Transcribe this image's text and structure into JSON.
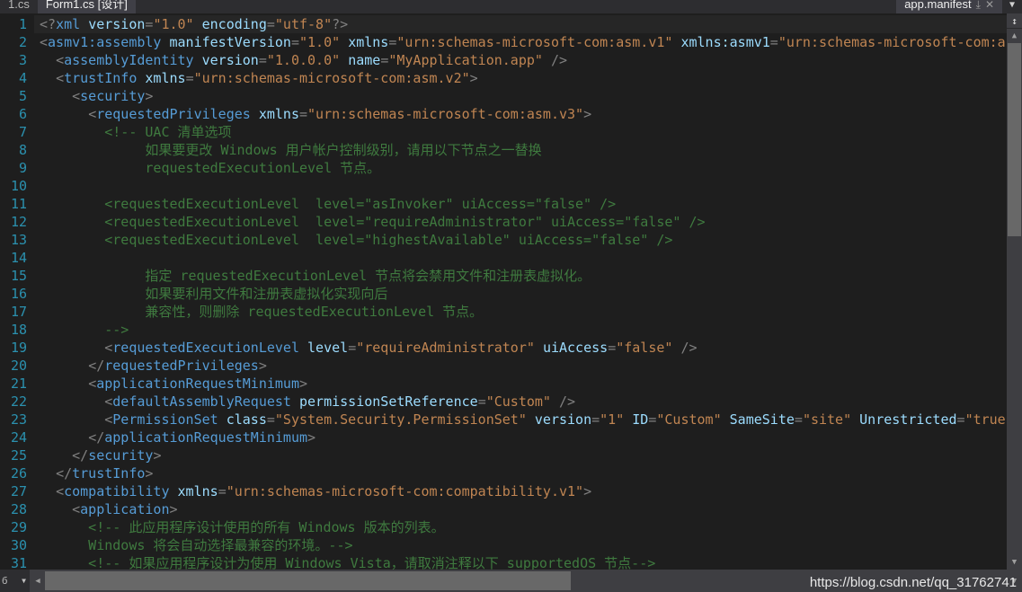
{
  "window": {
    "theme_background": "#1e1e1e",
    "accent_color": "#569cd6"
  },
  "tabs": {
    "items": [
      {
        "label": "1.cs",
        "state": "inactive",
        "truncated": true
      },
      {
        "label": "Form1.cs [设计]",
        "state": "active"
      }
    ],
    "right_tab": {
      "label": "app.manifest",
      "state": "active",
      "pin_icon": "⤓",
      "close_icon": "✕"
    },
    "overflow_icon": "▼"
  },
  "editor": {
    "language": "XML",
    "current_line": 1,
    "lines": [
      {
        "n": "1",
        "current": true,
        "tokens": [
          {
            "c": "punct",
            "t": "<?"
          },
          {
            "c": "tag",
            "t": "xml"
          },
          {
            "c": "plain",
            "t": " "
          },
          {
            "c": "attr",
            "t": "version"
          },
          {
            "c": "punct",
            "t": "="
          },
          {
            "c": "val",
            "t": "\"1.0\""
          },
          {
            "c": "plain",
            "t": " "
          },
          {
            "c": "attr",
            "t": "encoding"
          },
          {
            "c": "punct",
            "t": "="
          },
          {
            "c": "val",
            "t": "\"utf-8\""
          },
          {
            "c": "punct",
            "t": "?>"
          }
        ]
      },
      {
        "n": "2",
        "tokens": [
          {
            "c": "punct",
            "t": "<"
          },
          {
            "c": "tag",
            "t": "asmv1:assembly"
          },
          {
            "c": "plain",
            "t": " "
          },
          {
            "c": "attr",
            "t": "manifestVersion"
          },
          {
            "c": "punct",
            "t": "="
          },
          {
            "c": "val",
            "t": "\"1.0\""
          },
          {
            "c": "plain",
            "t": " "
          },
          {
            "c": "attr",
            "t": "xmlns"
          },
          {
            "c": "punct",
            "t": "="
          },
          {
            "c": "val",
            "t": "\"urn:schemas-microsoft-com:asm.v1\""
          },
          {
            "c": "plain",
            "t": " "
          },
          {
            "c": "attr",
            "t": "xmlns:asmv1"
          },
          {
            "c": "punct",
            "t": "="
          },
          {
            "c": "val",
            "t": "\"urn:schemas-microsoft-com:a"
          }
        ]
      },
      {
        "n": "3",
        "tokens": [
          {
            "c": "plain",
            "t": "  "
          },
          {
            "c": "punct",
            "t": "<"
          },
          {
            "c": "tag",
            "t": "assemblyIdentity"
          },
          {
            "c": "plain",
            "t": " "
          },
          {
            "c": "attr",
            "t": "version"
          },
          {
            "c": "punct",
            "t": "="
          },
          {
            "c": "val",
            "t": "\"1.0.0.0\""
          },
          {
            "c": "plain",
            "t": " "
          },
          {
            "c": "attr",
            "t": "name"
          },
          {
            "c": "punct",
            "t": "="
          },
          {
            "c": "val",
            "t": "\"MyApplication.app\""
          },
          {
            "c": "plain",
            "t": " "
          },
          {
            "c": "punct",
            "t": "/>"
          }
        ]
      },
      {
        "n": "4",
        "tokens": [
          {
            "c": "plain",
            "t": "  "
          },
          {
            "c": "punct",
            "t": "<"
          },
          {
            "c": "tag",
            "t": "trustInfo"
          },
          {
            "c": "plain",
            "t": " "
          },
          {
            "c": "attr",
            "t": "xmlns"
          },
          {
            "c": "punct",
            "t": "="
          },
          {
            "c": "val",
            "t": "\"urn:schemas-microsoft-com:asm.v2\""
          },
          {
            "c": "punct",
            "t": ">"
          }
        ]
      },
      {
        "n": "5",
        "tokens": [
          {
            "c": "plain",
            "t": "    "
          },
          {
            "c": "punct",
            "t": "<"
          },
          {
            "c": "tag",
            "t": "security"
          },
          {
            "c": "punct",
            "t": ">"
          }
        ]
      },
      {
        "n": "6",
        "tokens": [
          {
            "c": "plain",
            "t": "      "
          },
          {
            "c": "punct",
            "t": "<"
          },
          {
            "c": "tag",
            "t": "requestedPrivileges"
          },
          {
            "c": "plain",
            "t": " "
          },
          {
            "c": "attr",
            "t": "xmlns"
          },
          {
            "c": "punct",
            "t": "="
          },
          {
            "c": "val",
            "t": "\"urn:schemas-microsoft-com:asm.v3\""
          },
          {
            "c": "punct",
            "t": ">"
          }
        ]
      },
      {
        "n": "7",
        "tokens": [
          {
            "c": "comment",
            "t": "        <!-- UAC 清单选项"
          }
        ]
      },
      {
        "n": "8",
        "tokens": [
          {
            "c": "comment",
            "t": "             如果要更改 Windows 用户帐户控制级别，请用以下节点之一替换"
          }
        ]
      },
      {
        "n": "9",
        "tokens": [
          {
            "c": "comment",
            "t": "             requestedExecutionLevel 节点。"
          }
        ]
      },
      {
        "n": "10",
        "tokens": [
          {
            "c": "comment",
            "t": ""
          }
        ]
      },
      {
        "n": "11",
        "tokens": [
          {
            "c": "comment",
            "t": "        <requestedExecutionLevel  level=\"asInvoker\" uiAccess=\"false\" />"
          }
        ]
      },
      {
        "n": "12",
        "tokens": [
          {
            "c": "comment",
            "t": "        <requestedExecutionLevel  level=\"requireAdministrator\" uiAccess=\"false\" />"
          }
        ]
      },
      {
        "n": "13",
        "tokens": [
          {
            "c": "comment",
            "t": "        <requestedExecutionLevel  level=\"highestAvailable\" uiAccess=\"false\" />"
          }
        ]
      },
      {
        "n": "14",
        "tokens": [
          {
            "c": "comment",
            "t": ""
          }
        ]
      },
      {
        "n": "15",
        "tokens": [
          {
            "c": "comment",
            "t": "             指定 requestedExecutionLevel 节点将会禁用文件和注册表虚拟化。"
          }
        ]
      },
      {
        "n": "16",
        "tokens": [
          {
            "c": "comment",
            "t": "             如果要利用文件和注册表虚拟化实现向后"
          }
        ]
      },
      {
        "n": "17",
        "tokens": [
          {
            "c": "comment",
            "t": "             兼容性，则删除 requestedExecutionLevel 节点。"
          }
        ]
      },
      {
        "n": "18",
        "tokens": [
          {
            "c": "comment",
            "t": "        -->"
          }
        ]
      },
      {
        "n": "19",
        "tokens": [
          {
            "c": "plain",
            "t": "        "
          },
          {
            "c": "punct",
            "t": "<"
          },
          {
            "c": "tag",
            "t": "requestedExecutionLevel"
          },
          {
            "c": "plain",
            "t": " "
          },
          {
            "c": "attr",
            "t": "level"
          },
          {
            "c": "punct",
            "t": "="
          },
          {
            "c": "val",
            "t": "\"requireAdministrator\""
          },
          {
            "c": "plain",
            "t": " "
          },
          {
            "c": "attr",
            "t": "uiAccess"
          },
          {
            "c": "punct",
            "t": "="
          },
          {
            "c": "val",
            "t": "\"false\""
          },
          {
            "c": "plain",
            "t": " "
          },
          {
            "c": "punct",
            "t": "/>"
          }
        ]
      },
      {
        "n": "20",
        "tokens": [
          {
            "c": "plain",
            "t": "      "
          },
          {
            "c": "punct",
            "t": "</"
          },
          {
            "c": "tag",
            "t": "requestedPrivileges"
          },
          {
            "c": "punct",
            "t": ">"
          }
        ]
      },
      {
        "n": "21",
        "tokens": [
          {
            "c": "plain",
            "t": "      "
          },
          {
            "c": "punct",
            "t": "<"
          },
          {
            "c": "tag",
            "t": "applicationRequestMinimum"
          },
          {
            "c": "punct",
            "t": ">"
          }
        ]
      },
      {
        "n": "22",
        "tokens": [
          {
            "c": "plain",
            "t": "        "
          },
          {
            "c": "punct",
            "t": "<"
          },
          {
            "c": "tag",
            "t": "defaultAssemblyRequest"
          },
          {
            "c": "plain",
            "t": " "
          },
          {
            "c": "attr",
            "t": "permissionSetReference"
          },
          {
            "c": "punct",
            "t": "="
          },
          {
            "c": "val",
            "t": "\"Custom\""
          },
          {
            "c": "plain",
            "t": " "
          },
          {
            "c": "punct",
            "t": "/>"
          }
        ]
      },
      {
        "n": "23",
        "tokens": [
          {
            "c": "plain",
            "t": "        "
          },
          {
            "c": "punct",
            "t": "<"
          },
          {
            "c": "tag",
            "t": "PermissionSet"
          },
          {
            "c": "plain",
            "t": " "
          },
          {
            "c": "attr",
            "t": "class"
          },
          {
            "c": "punct",
            "t": "="
          },
          {
            "c": "val",
            "t": "\"System.Security.PermissionSet\""
          },
          {
            "c": "plain",
            "t": " "
          },
          {
            "c": "attr",
            "t": "version"
          },
          {
            "c": "punct",
            "t": "="
          },
          {
            "c": "val",
            "t": "\"1\""
          },
          {
            "c": "plain",
            "t": " "
          },
          {
            "c": "attr",
            "t": "ID"
          },
          {
            "c": "punct",
            "t": "="
          },
          {
            "c": "val",
            "t": "\"Custom\""
          },
          {
            "c": "plain",
            "t": " "
          },
          {
            "c": "attr",
            "t": "SameSite"
          },
          {
            "c": "punct",
            "t": "="
          },
          {
            "c": "val",
            "t": "\"site\""
          },
          {
            "c": "plain",
            "t": " "
          },
          {
            "c": "attr",
            "t": "Unrestricted"
          },
          {
            "c": "punct",
            "t": "="
          },
          {
            "c": "val",
            "t": "\"true"
          }
        ]
      },
      {
        "n": "24",
        "tokens": [
          {
            "c": "plain",
            "t": "      "
          },
          {
            "c": "punct",
            "t": "</"
          },
          {
            "c": "tag",
            "t": "applicationRequestMinimum"
          },
          {
            "c": "punct",
            "t": ">"
          }
        ]
      },
      {
        "n": "25",
        "tokens": [
          {
            "c": "plain",
            "t": "    "
          },
          {
            "c": "punct",
            "t": "</"
          },
          {
            "c": "tag",
            "t": "security"
          },
          {
            "c": "punct",
            "t": ">"
          }
        ]
      },
      {
        "n": "26",
        "tokens": [
          {
            "c": "plain",
            "t": "  "
          },
          {
            "c": "punct",
            "t": "</"
          },
          {
            "c": "tag",
            "t": "trustInfo"
          },
          {
            "c": "punct",
            "t": ">"
          }
        ]
      },
      {
        "n": "27",
        "tokens": [
          {
            "c": "plain",
            "t": "  "
          },
          {
            "c": "punct",
            "t": "<"
          },
          {
            "c": "tag",
            "t": "compatibility"
          },
          {
            "c": "plain",
            "t": " "
          },
          {
            "c": "attr",
            "t": "xmlns"
          },
          {
            "c": "punct",
            "t": "="
          },
          {
            "c": "val",
            "t": "\"urn:schemas-microsoft-com:compatibility.v1\""
          },
          {
            "c": "punct",
            "t": ">"
          }
        ]
      },
      {
        "n": "28",
        "tokens": [
          {
            "c": "plain",
            "t": "    "
          },
          {
            "c": "punct",
            "t": "<"
          },
          {
            "c": "tag",
            "t": "application"
          },
          {
            "c": "punct",
            "t": ">"
          }
        ]
      },
      {
        "n": "29",
        "tokens": [
          {
            "c": "comment",
            "t": "      <!-- 此应用程序设计使用的所有 Windows 版本的列表。"
          }
        ]
      },
      {
        "n": "30",
        "tokens": [
          {
            "c": "comment",
            "t": "      Windows 将会自动选择最兼容的环境。-->"
          }
        ]
      },
      {
        "n": "31",
        "tokens": [
          {
            "c": "comment",
            "t": "      <!-- 如果应用程序设计为使用 Windows Vista，请取消注释以下 supportedOS 节点-->"
          }
        ]
      }
    ]
  },
  "scrollbars": {
    "vertical": {
      "up_arrow": "▲",
      "down_arrow": "▼",
      "split_icon": "↕"
    },
    "horizontal": {
      "left_arrow": "◀",
      "right_arrow": "▶"
    }
  },
  "status": {
    "combo_value": "б",
    "combo_caret": "▼"
  },
  "watermark": {
    "text": "https://blog.csdn.net/qq_31762741"
  }
}
